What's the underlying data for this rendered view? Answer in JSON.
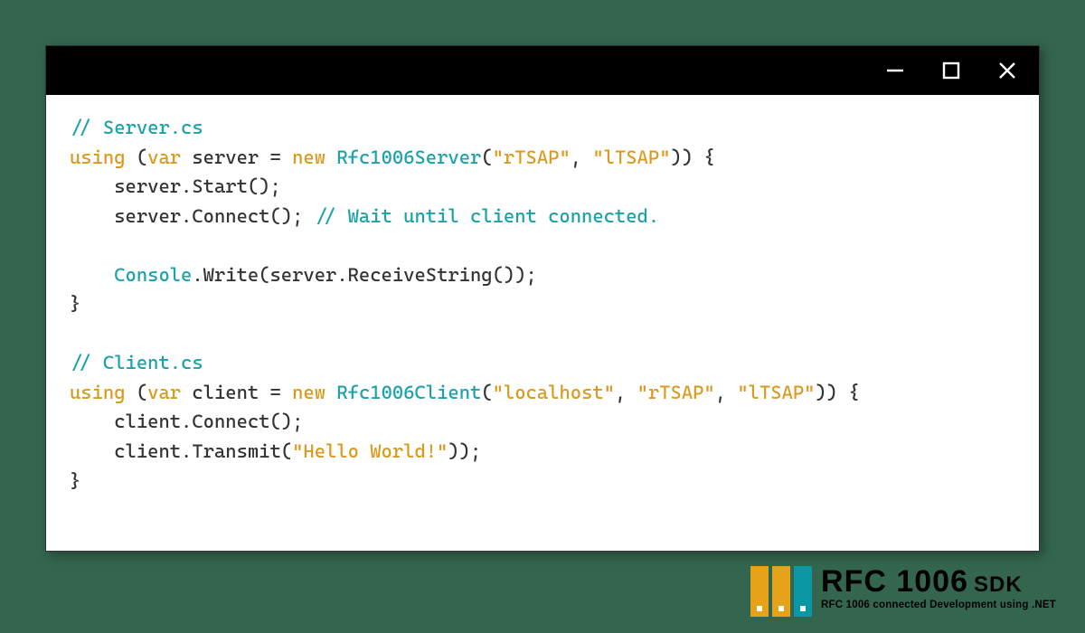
{
  "window": {
    "minimize_label": "Minimize",
    "maximize_label": "Maximize",
    "close_label": "Close"
  },
  "code": {
    "l1_comment": "// Server.cs",
    "l2_kw_using": "using",
    "l2_p1": " (",
    "l2_kw_var": "var",
    "l2_p2": " server = ",
    "l2_kw_new": "new",
    "l2_p3": " ",
    "l2_type": "Rfc1006Server",
    "l2_p4": "(",
    "l2_str1": "\"rTSAP\"",
    "l2_p5": ", ",
    "l2_str2": "\"lTSAP\"",
    "l2_p6": ")) {",
    "l3": "server.Start();",
    "l4_a": "server.Connect(); ",
    "l4_comment": "// Wait until client connected.",
    "l6_type": "Console",
    "l6_b": ".Write(server.ReceiveString());",
    "l7": "}",
    "l9_comment": "// Client.cs",
    "l10_kw_using": "using",
    "l10_p1": " (",
    "l10_kw_var": "var",
    "l10_p2": " client = ",
    "l10_kw_new": "new",
    "l10_p3": " ",
    "l10_type": "Rfc1006Client",
    "l10_p4": "(",
    "l10_str1": "\"localhost\"",
    "l10_p5": ", ",
    "l10_str2": "\"rTSAP\"",
    "l10_p6": ", ",
    "l10_str3": "\"lTSAP\"",
    "l10_p7": ")) {",
    "l11": "client.Connect();",
    "l12_a": "client.Transmit(",
    "l12_str": "\"Hello World!\"",
    "l12_b": "));",
    "l13": "}"
  },
  "logo": {
    "title_main": "RFC 1006",
    "title_sdk": "SDK",
    "subtitle": "RFC 1006 connected Development using .NET"
  }
}
